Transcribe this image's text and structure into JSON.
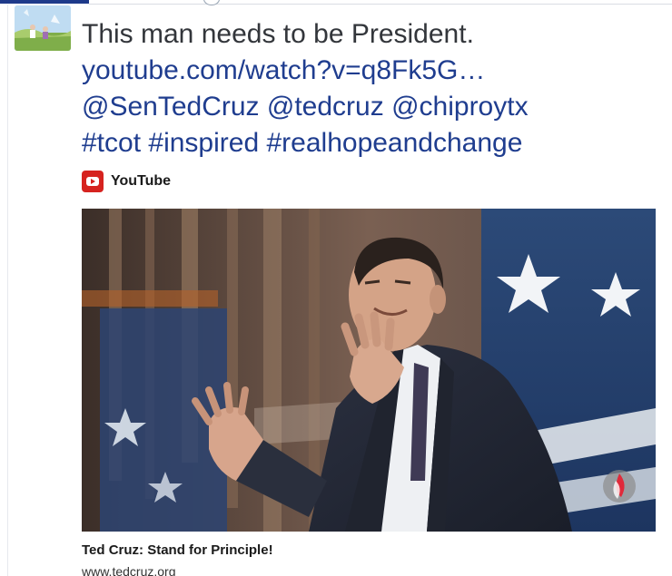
{
  "tweet": {
    "text": "This man needs to be President.",
    "link": "youtube.com/watch?v=q8Fk5G…",
    "mentions": [
      "@SenTedCruz",
      "@tedcruz",
      "@chiproytx"
    ],
    "hashtags": [
      "#tcot",
      "#inspired",
      "#realhopeandchange"
    ]
  },
  "card": {
    "source_icon": "youtube-icon",
    "source_name": "YouTube",
    "video_title": "Ted Cruz: Stand for Principle!",
    "video_url": "www.tedcruz.org"
  },
  "colors": {
    "link": "#1f3d8f",
    "text": "#33363b",
    "youtube_red": "#d6231f"
  }
}
